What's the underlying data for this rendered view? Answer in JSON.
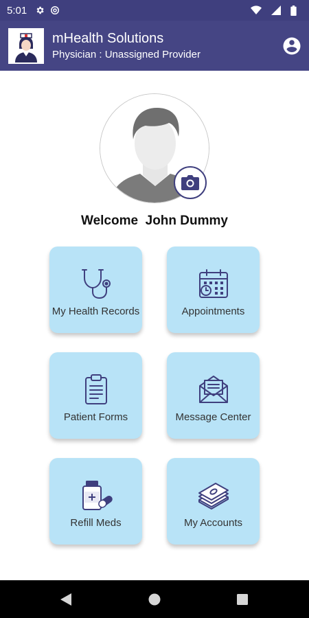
{
  "status_bar": {
    "time": "5:01",
    "icons": [
      "gear-icon",
      "at-sign-icon",
      "wifi-icon",
      "signal-icon",
      "battery-icon"
    ]
  },
  "app_bar": {
    "title": "mHealth Solutions",
    "subtitle": "Physician : Unassigned Provider",
    "logo": "nurse-logo",
    "account_icon": "account-circle-icon",
    "color": "#454584"
  },
  "profile": {
    "avatar": "avatar-placeholder",
    "camera_icon": "camera-icon",
    "welcome": "Welcome  John Dummy"
  },
  "tiles": [
    {
      "label": "My Health Records",
      "icon": "stethoscope-icon"
    },
    {
      "label": "Appointments",
      "icon": "calendar-icon"
    },
    {
      "label": "Patient Forms",
      "icon": "clipboard-icon"
    },
    {
      "label": "Message Center",
      "icon": "envelope-icon"
    },
    {
      "label": "Refill Meds",
      "icon": "pill-bottle-icon"
    },
    {
      "label": "My Accounts",
      "icon": "money-stack-icon"
    }
  ],
  "colors": {
    "tile_background": "#b8e3f7",
    "icon_stroke": "#3f3f7e",
    "status_bar": "#3f3f7e"
  },
  "nav_bar": {
    "back_icon": "back-icon",
    "home_icon": "home-icon",
    "recents_icon": "recents-icon"
  }
}
